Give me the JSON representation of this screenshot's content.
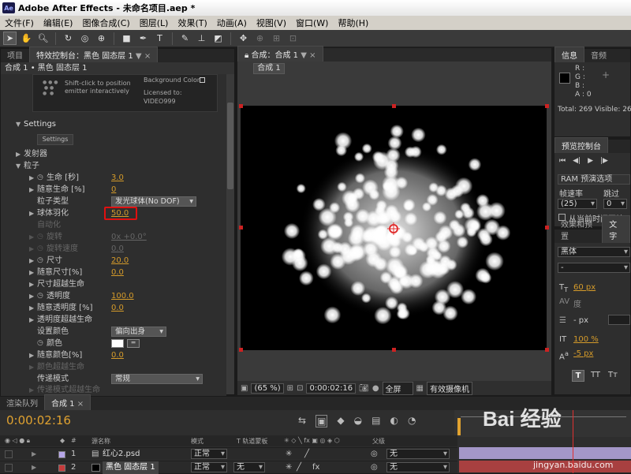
{
  "window": {
    "title": "Adobe After Effects - 未命名项目.aep *",
    "logo": "Ae"
  },
  "menu": [
    "文件(F)",
    "编辑(E)",
    "图像合成(C)",
    "图层(L)",
    "效果(T)",
    "动画(A)",
    "视图(V)",
    "窗口(W)",
    "帮助(H)"
  ],
  "left_panel": {
    "tab_project": "项目",
    "tab_effects": "特效控制台：黑色 固态层 1",
    "breadcrumb": "合成 1 • 黑色 固态层 1",
    "hint_text": "Shift-click to position emitter interactively",
    "bg_color_label": "Background Color",
    "licensed_label": "Licensed to:",
    "licensed_name": "VIDEO999",
    "settings_header": "Settings",
    "settings_button": "Settings",
    "groups": [
      "发射器",
      "粒子"
    ],
    "props": [
      {
        "name": "生命 [秒]",
        "value": "3.0"
      },
      {
        "name": "随意生命 [%]",
        "value": "0"
      },
      {
        "name": "粒子类型",
        "value": "发光球体(No DOF)"
      },
      {
        "name": "球体羽化",
        "value": "50.0"
      },
      {
        "name": "自动化",
        "value": ""
      },
      {
        "name": "旋转",
        "value": "0x +0.0°"
      },
      {
        "name": "旋转速度",
        "value": "0.0"
      },
      {
        "name": "尺寸",
        "value": "20.0"
      },
      {
        "name": "随意尺寸[%]",
        "value": "0.0"
      },
      {
        "name": "尺寸超越生命",
        "value": ""
      },
      {
        "name": "透明度",
        "value": "100.0"
      },
      {
        "name": "随意透明度 [%]",
        "value": "0.0"
      },
      {
        "name": "透明度超越生命",
        "value": ""
      },
      {
        "name": "设置颜色",
        "value": "偏向出身"
      },
      {
        "name": "颜色",
        "value": ""
      },
      {
        "name": "随意颜色[%]",
        "value": "0.0"
      },
      {
        "name": "颜色超越生命",
        "value": ""
      },
      {
        "name": "传递模式",
        "value": "常规"
      },
      {
        "name": "传递模式超越生命",
        "value": ""
      }
    ]
  },
  "comp_panel": {
    "tab": "合成：合成 1",
    "subtab": "合成 1",
    "zoom": "(65 %)",
    "timecode": "0:00:02:16",
    "resolution": "全屏",
    "camera": "有效摄像机"
  },
  "info_panel": {
    "tab_info": "信息",
    "tab_audio": "音频",
    "r": "R :",
    "g": "G :",
    "b": "B :",
    "a": "A : 0",
    "total": "Total: 269",
    "visible": "Visible: 265"
  },
  "preview_panel": {
    "tab": "预览控制台",
    "ram": "RAM 预演选项",
    "fps_label": "帧速率",
    "skip_label": "跳过",
    "fps_value": "(25)",
    "skip_value": "0",
    "from_current": "从当前时间开始"
  },
  "text_panel": {
    "tab_presets": "效果和预置",
    "tab_text": "文字",
    "font": "黑体",
    "style": "-",
    "size": "60 px",
    "tracking": "度",
    "leading": "- px",
    "scale": "100 %",
    "baseline": "-5 px",
    "t_buttons": [
      "T",
      "TT",
      "Tт"
    ]
  },
  "timeline": {
    "tab_render": "渲染队列",
    "tab_comp": "合成 1",
    "timecode": "0:00:02:16",
    "headers": {
      "num": "#",
      "source": "源名称",
      "mode": "模式",
      "trkmat": "T 轨道蒙板",
      "parent": "父级"
    },
    "layers": [
      {
        "num": "1",
        "name": "红心2.psd",
        "mode": "正常",
        "parent": "无",
        "color": "#b6a6e8"
      },
      {
        "num": "2",
        "name": "黑色 固态层 1",
        "mode": "正常",
        "trkmat": "无",
        "parent": "无",
        "color": "#c53b3b"
      }
    ]
  },
  "watermark": {
    "text": "Bai 经验",
    "url": "jingyan.baidu.com"
  }
}
